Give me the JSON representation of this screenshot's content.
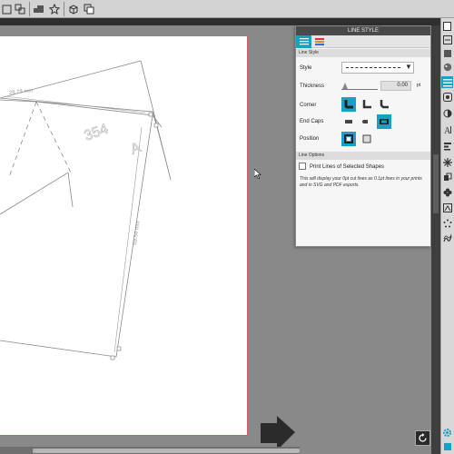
{
  "panel": {
    "title": "LINE STYLE",
    "section_line_style": "Line Style",
    "style_label": "Style",
    "thickness_label": "Thickness",
    "thickness_value": "0.00",
    "thickness_unit": "pt",
    "thickness_slider_fraction": 0.0,
    "corner_label": "Corner",
    "end_caps_label": "End Caps",
    "position_label": "Position",
    "section_line_options": "Line Options",
    "print_lines_label": "Print Lines of Selected Shapes",
    "print_lines_checked": false,
    "info_text": "This will display your 0pt cut lines as 0.1pt lines in your prints and in SVG and PDF exports."
  },
  "canvas": {
    "dim_top": "28.79 mm",
    "dim_side": "69.54 mm",
    "shape_label": "354",
    "shape_letter": "A"
  },
  "colors": {
    "accent": "#1a9fc7",
    "page_border": "#d06060"
  }
}
